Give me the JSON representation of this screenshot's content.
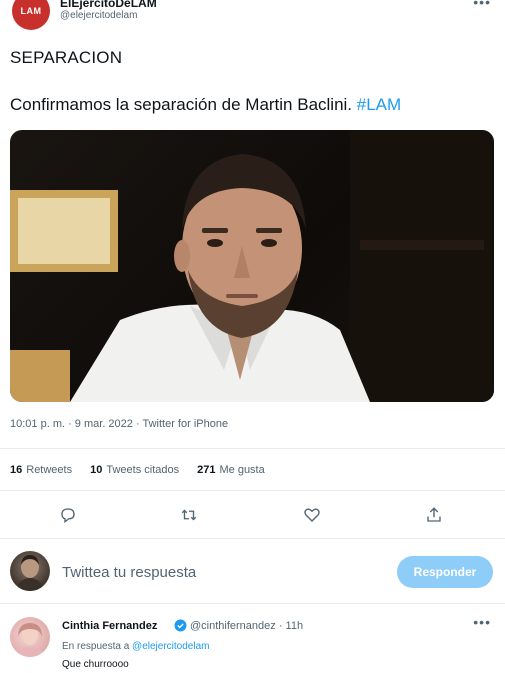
{
  "author": {
    "avatar_label": "LAM",
    "display_name": "ElEjercitoDeLAM",
    "handle": "@elejercitodelam"
  },
  "tweet": {
    "line1": "SEPARACION",
    "line2_text": "Confirmamos la separación de Martin Baclini. ",
    "hashtag": "#LAM",
    "timestamp": "10:01 p. m. · 9 mar. 2022 · Twitter for iPhone"
  },
  "stats": {
    "retweets_count": "16",
    "retweets_label": "Retweets",
    "quotes_count": "10",
    "quotes_label": "Tweets citados",
    "likes_count": "271",
    "likes_label": "Me gusta"
  },
  "reply_box": {
    "prompt": "Twittea tu respuesta",
    "button_label": "Responder",
    "button_color": "#8ecdf8"
  },
  "reply": {
    "display_name": "Cinthia Fernandez",
    "handle": "@cinthifernandez · 11h",
    "replying_prefix": "En respuesta a ",
    "replying_to": "@elejercitodelam",
    "text": "Que churroooo"
  },
  "colors": {
    "accent": "#1d9bf0",
    "secondary_text": "#536471",
    "avatar_red": "#c8302c"
  },
  "icons": [
    "more-icon",
    "reply-icon",
    "retweet-icon",
    "like-icon",
    "share-icon",
    "verified-icon"
  ]
}
